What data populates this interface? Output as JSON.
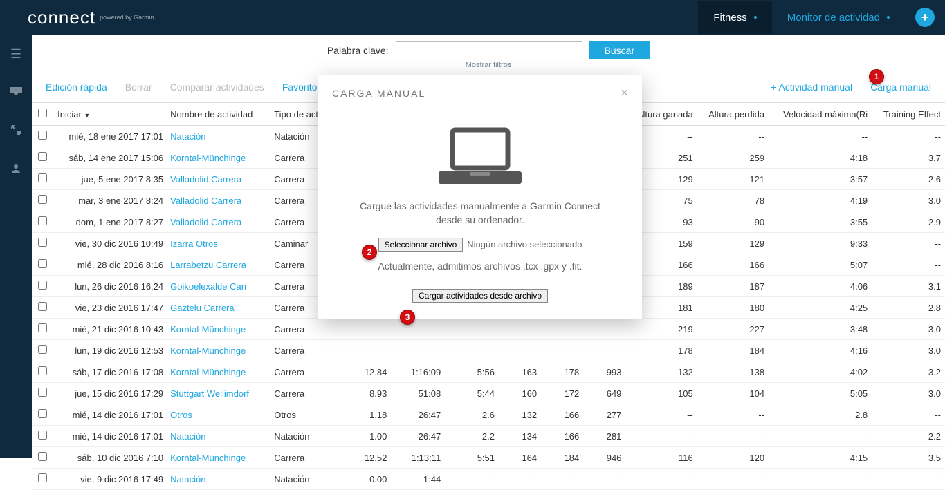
{
  "topbar": {
    "logo": "connect",
    "powered": "powered by Garmin",
    "tab_fitness": "Fitness",
    "tab_monitor": "Monitor de actividad"
  },
  "search": {
    "label": "Palabra clave:",
    "button": "Buscar",
    "filters": "Mostrar filtros"
  },
  "toolbar": {
    "quick_edit": "Edición rápida",
    "delete": "Borrar",
    "compare": "Comparar actividades",
    "favorites": "Favoritos",
    "manual_activity": "+ Actividad manual",
    "manual_upload": "Carga manual"
  },
  "cols": {
    "chk": "",
    "start": "Iniciar",
    "name": "Nombre de actividad",
    "type": "Tipo de activida",
    "c5": "",
    "c6": "",
    "c7": "",
    "c8": "",
    "c9": "",
    "c10": "",
    "elev_gain": "Altura ganada",
    "elev_loss": "Altura perdida",
    "max_speed": "Velocidad máxima(Ri",
    "te": "Training Effect"
  },
  "rows": [
    {
      "date": "mié, 18 ene 2017 17:01",
      "name": "Natación",
      "type": "Natación",
      "c5": "",
      "c6": "",
      "c7": "",
      "c8": "",
      "c9": "",
      "c10": "",
      "eg": "--",
      "el": "--",
      "ms": "--",
      "te": "--"
    },
    {
      "date": "sáb, 14 ene 2017 15:06",
      "name": "Korntal-Münchinge",
      "type": "Carrera",
      "c5": "",
      "c6": "",
      "c7": "",
      "c8": "",
      "c9": "",
      "c10": "",
      "eg": "251",
      "el": "259",
      "ms": "4:18",
      "te": "3.7"
    },
    {
      "date": "jue, 5 ene 2017 8:35",
      "name": "Valladolid Carrera",
      "type": "Carrera",
      "c5": "",
      "c6": "",
      "c7": "",
      "c8": "",
      "c9": "",
      "c10": "",
      "eg": "129",
      "el": "121",
      "ms": "3:57",
      "te": "2.6"
    },
    {
      "date": "mar, 3 ene 2017 8:24",
      "name": "Valladolid Carrera",
      "type": "Carrera",
      "c5": "",
      "c6": "",
      "c7": "",
      "c8": "",
      "c9": "",
      "c10": "",
      "eg": "75",
      "el": "78",
      "ms": "4:19",
      "te": "3.0"
    },
    {
      "date": "dom, 1 ene 2017 8:27",
      "name": "Valladolid Carrera",
      "type": "Carrera",
      "c5": "",
      "c6": "",
      "c7": "",
      "c8": "",
      "c9": "",
      "c10": "",
      "eg": "93",
      "el": "90",
      "ms": "3:55",
      "te": "2.9"
    },
    {
      "date": "vie, 30 dic 2016 10:49",
      "name": "Izarra Otros",
      "type": "Caminar",
      "c5": "",
      "c6": "",
      "c7": "",
      "c8": "",
      "c9": "",
      "c10": "",
      "eg": "159",
      "el": "129",
      "ms": "9:33",
      "te": "--"
    },
    {
      "date": "mié, 28 dic 2016 8:16",
      "name": "Larrabetzu Carrera",
      "type": "Carrera",
      "c5": "",
      "c6": "",
      "c7": "",
      "c8": "",
      "c9": "",
      "c10": "",
      "eg": "166",
      "el": "166",
      "ms": "5:07",
      "te": "--"
    },
    {
      "date": "lun, 26 dic 2016 16:24",
      "name": "Goikoelexalde Carr",
      "type": "Carrera",
      "c5": "",
      "c6": "",
      "c7": "",
      "c8": "",
      "c9": "",
      "c10": "",
      "eg": "189",
      "el": "187",
      "ms": "4:06",
      "te": "3.1"
    },
    {
      "date": "vie, 23 dic 2016 17:47",
      "name": "Gaztelu Carrera",
      "type": "Carrera",
      "c5": "",
      "c6": "",
      "c7": "",
      "c8": "",
      "c9": "",
      "c10": "",
      "eg": "181",
      "el": "180",
      "ms": "4:25",
      "te": "2.8"
    },
    {
      "date": "mié, 21 dic 2016 10:43",
      "name": "Korntal-Münchinge",
      "type": "Carrera",
      "c5": "",
      "c6": "",
      "c7": "",
      "c8": "",
      "c9": "",
      "c10": "",
      "eg": "219",
      "el": "227",
      "ms": "3:48",
      "te": "3.0"
    },
    {
      "date": "lun, 19 dic 2016 12:53",
      "name": "Korntal-Münchinge",
      "type": "Carrera",
      "c5": "",
      "c6": "",
      "c7": "",
      "c8": "",
      "c9": "",
      "c10": "",
      "eg": "178",
      "el": "184",
      "ms": "4:16",
      "te": "3.0"
    },
    {
      "date": "sáb, 17 dic 2016 17:08",
      "name": "Korntal-Münchinge",
      "type": "Carrera",
      "c5": "12.84",
      "c6": "1:16:09",
      "c7": "5:56",
      "c8": "163",
      "c9": "178",
      "c10": "993",
      "eg": "132",
      "el": "138",
      "ms": "4:02",
      "te": "3.2"
    },
    {
      "date": "jue, 15 dic 2016 17:29",
      "name": "Stuttgart Weilimdorf",
      "type": "Carrera",
      "c5": "8.93",
      "c6": "51:08",
      "c7": "5:44",
      "c8": "160",
      "c9": "172",
      "c10": "649",
      "eg": "105",
      "el": "104",
      "ms": "5:05",
      "te": "3.0"
    },
    {
      "date": "mié, 14 dic 2016 17:01",
      "name": "Otros",
      "type": "Otros",
      "c5": "1.18",
      "c6": "26:47",
      "c7": "2.6",
      "c8": "132",
      "c9": "166",
      "c10": "277",
      "eg": "--",
      "el": "--",
      "ms": "2.8",
      "te": "--"
    },
    {
      "date": "mié, 14 dic 2016 17:01",
      "name": "Natación",
      "type": "Natación",
      "c5": "1.00",
      "c6": "26:47",
      "c7": "2.2",
      "c8": "134",
      "c9": "166",
      "c10": "281",
      "eg": "--",
      "el": "--",
      "ms": "--",
      "te": "2.2"
    },
    {
      "date": "sáb, 10 dic 2016 7:10",
      "name": "Korntal-Münchinge",
      "type": "Carrera",
      "c5": "12.52",
      "c6": "1:13:11",
      "c7": "5:51",
      "c8": "164",
      "c9": "184",
      "c10": "946",
      "eg": "116",
      "el": "120",
      "ms": "4:15",
      "te": "3.5"
    },
    {
      "date": "vie, 9 dic 2016 17:49",
      "name": "Natación",
      "type": "Natación",
      "c5": "0.00",
      "c6": "1:44",
      "c7": "--",
      "c8": "--",
      "c9": "--",
      "c10": "--",
      "eg": "--",
      "el": "--",
      "ms": "--",
      "te": "--"
    }
  ],
  "modal": {
    "title": "CARGA MANUAL",
    "desc": "Cargue las actividades manualmente a Garmin Connect desde su ordenador.",
    "select_file": "Seleccionar archivo",
    "no_file": "Ningún archivo seleccionado",
    "supported": "Actualmente, admitimos archivos .tcx .gpx y .fit.",
    "upload": "Cargar actividades desde archivo"
  },
  "anno": {
    "a1": "1",
    "a2": "2",
    "a3": "3"
  }
}
